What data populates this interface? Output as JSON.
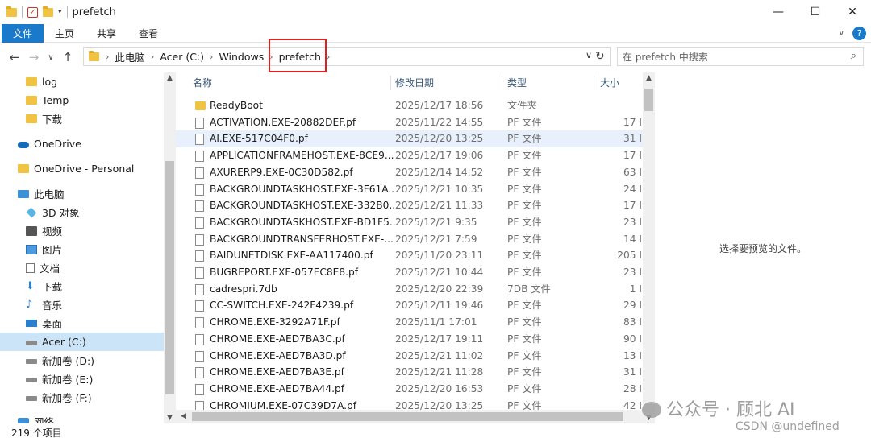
{
  "window": {
    "title": "prefetch",
    "minimize": "—",
    "maximize": "☐",
    "close": "✕"
  },
  "ribbon": {
    "tabs": [
      "文件",
      "主页",
      "共享",
      "查看"
    ],
    "help": "?",
    "expand": "∨"
  },
  "address": {
    "back": "←",
    "forward": "→",
    "recent": "∨",
    "up": "↑",
    "crumbs": [
      "此电脑",
      "Acer (C:)",
      "Windows",
      "prefetch"
    ],
    "search_placeholder": "在 prefetch 中搜索"
  },
  "nav": [
    {
      "label": "log",
      "icon": "folder-icon"
    },
    {
      "label": "Temp",
      "icon": "folder-icon"
    },
    {
      "label": "下载",
      "icon": "folder-icon"
    },
    {
      "label": "OneDrive",
      "icon": "cloud-icon"
    },
    {
      "label": "OneDrive - Personal",
      "icon": "folder-icon"
    },
    {
      "label": "此电脑",
      "icon": "computer-icon"
    },
    {
      "label": "3D 对象",
      "icon": "cube-icon"
    },
    {
      "label": "视频",
      "icon": "video-icon"
    },
    {
      "label": "图片",
      "icon": "picture-icon"
    },
    {
      "label": "文档",
      "icon": "document-icon"
    },
    {
      "label": "下载",
      "icon": "download-icon"
    },
    {
      "label": "音乐",
      "icon": "music-icon"
    },
    {
      "label": "桌面",
      "icon": "desktop-icon"
    },
    {
      "label": "Acer (C:)",
      "icon": "drive-icon"
    },
    {
      "label": "新加卷 (D:)",
      "icon": "drive-icon"
    },
    {
      "label": "新加卷 (E:)",
      "icon": "drive-icon"
    },
    {
      "label": "新加卷 (F:)",
      "icon": "drive-icon"
    },
    {
      "label": "网络",
      "icon": "network-icon"
    }
  ],
  "columns": {
    "name": "名称",
    "date": "修改日期",
    "type": "类型",
    "size": "大小"
  },
  "files": [
    {
      "name": "ReadyBoot",
      "date": "2025/12/17 18:56",
      "type": "文件夹",
      "size": "",
      "folder": true
    },
    {
      "name": "ACTIVATION.EXE-20882DEF.pf",
      "date": "2025/11/22 14:55",
      "type": "PF 文件",
      "size": "17 I"
    },
    {
      "name": "AI.EXE-517C04F0.pf",
      "date": "2025/12/20 13:25",
      "type": "PF 文件",
      "size": "31 I"
    },
    {
      "name": "APPLICATIONFRAMEHOST.EXE-8CE9...",
      "date": "2025/12/17 19:06",
      "type": "PF 文件",
      "size": "17 I"
    },
    {
      "name": "AXURERP9.EXE-0C30D582.pf",
      "date": "2025/12/14 14:52",
      "type": "PF 文件",
      "size": "63 I"
    },
    {
      "name": "BACKGROUNDTASKHOST.EXE-3F61A...",
      "date": "2025/12/21 10:35",
      "type": "PF 文件",
      "size": "24 I"
    },
    {
      "name": "BACKGROUNDTASKHOST.EXE-332B0...",
      "date": "2025/12/21 11:33",
      "type": "PF 文件",
      "size": "17 I"
    },
    {
      "name": "BACKGROUNDTASKHOST.EXE-BD1F5...",
      "date": "2025/12/21 9:35",
      "type": "PF 文件",
      "size": "23 I"
    },
    {
      "name": "BACKGROUNDTRANSFERHOST.EXE-...",
      "date": "2025/12/21 7:59",
      "type": "PF 文件",
      "size": "14 I"
    },
    {
      "name": "BAIDUNETDISK.EXE-AA117400.pf",
      "date": "2025/11/20 23:11",
      "type": "PF 文件",
      "size": "205 I"
    },
    {
      "name": "BUGREPORT.EXE-057EC8E8.pf",
      "date": "2025/12/21 10:44",
      "type": "PF 文件",
      "size": "23 I"
    },
    {
      "name": "cadrespri.7db",
      "date": "2025/12/20 22:39",
      "type": "7DB 文件",
      "size": "1 I"
    },
    {
      "name": "CC-SWITCH.EXE-242F4239.pf",
      "date": "2025/12/11 19:46",
      "type": "PF 文件",
      "size": "29 I"
    },
    {
      "name": "CHROME.EXE-3292A71F.pf",
      "date": "2025/11/1 17:01",
      "type": "PF 文件",
      "size": "83 I"
    },
    {
      "name": "CHROME.EXE-AED7BA3C.pf",
      "date": "2025/12/17 19:11",
      "type": "PF 文件",
      "size": "90 I"
    },
    {
      "name": "CHROME.EXE-AED7BA3D.pf",
      "date": "2025/12/21 11:02",
      "type": "PF 文件",
      "size": "13 I"
    },
    {
      "name": "CHROME.EXE-AED7BA3E.pf",
      "date": "2025/12/21 11:28",
      "type": "PF 文件",
      "size": "31 I"
    },
    {
      "name": "CHROME.EXE-AED7BA44.pf",
      "date": "2025/12/20 16:53",
      "type": "PF 文件",
      "size": "28 I"
    },
    {
      "name": "CHROMIUM.EXE-07C39D7A.pf",
      "date": "2025/12/20 13:25",
      "type": "PF 文件",
      "size": "42 I"
    }
  ],
  "preview": {
    "message": "选择要预览的文件。"
  },
  "status": {
    "count": "219 个项目"
  },
  "watermark": {
    "line1": "公众号 · 顾北 AI",
    "line2": "CSDN @undefined"
  },
  "colors": {
    "ribbon_file": "#1979ca",
    "selection": "#cce4f7",
    "highlight_box": "#e02020"
  }
}
